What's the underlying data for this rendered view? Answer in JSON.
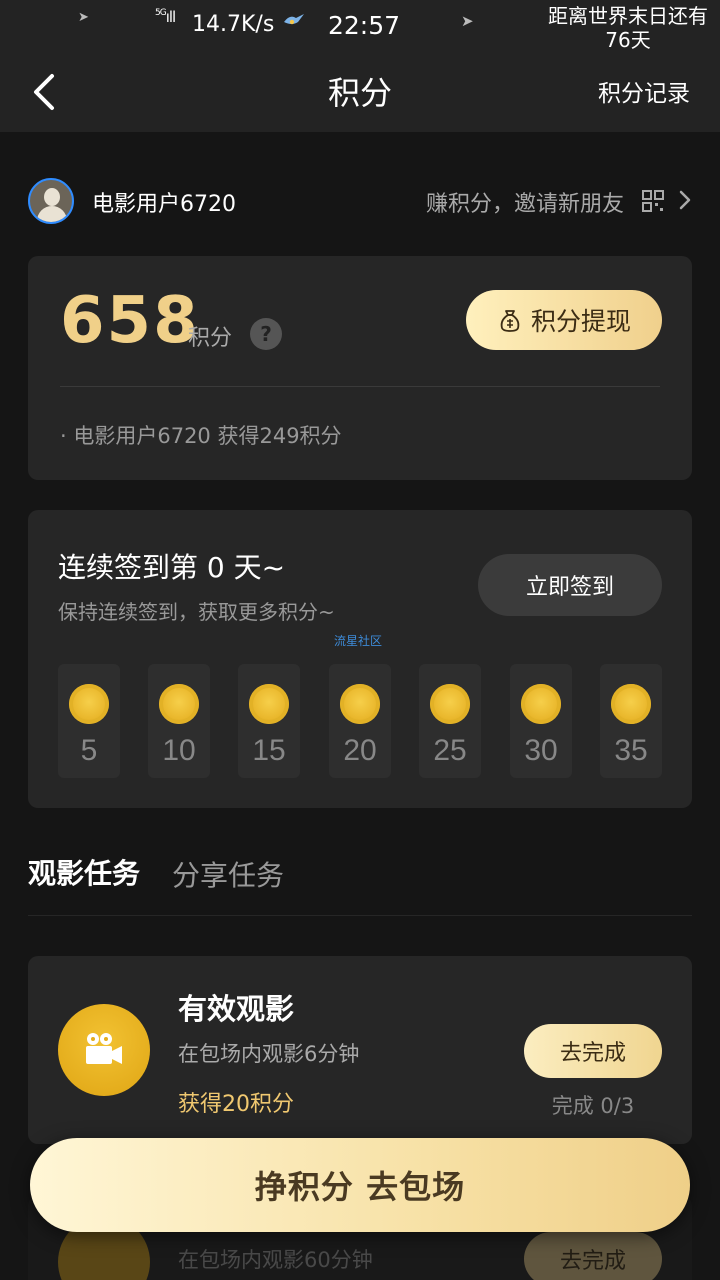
{
  "status_bar": {
    "network_speed": "14.7K/s",
    "time": "22:57",
    "signal_label": "5G",
    "countdown_text": "距离世界末日还有76天"
  },
  "nav": {
    "title": "积分",
    "record_label": "积分记录"
  },
  "user": {
    "name": "电影用户6720",
    "invite_text": "赚积分，邀请新朋友"
  },
  "points": {
    "value": "658",
    "unit": "积分",
    "help_symbol": "?",
    "withdraw_label": "积分提现",
    "gain_text": "· 电影用户6720 获得249积分"
  },
  "signin": {
    "title": "连续签到第 0 天~",
    "subtitle": "保持连续签到，获取更多积分~",
    "button_label": "立即签到",
    "watermark": "流星社区",
    "days": [
      {
        "value": "5"
      },
      {
        "value": "10"
      },
      {
        "value": "15"
      },
      {
        "value": "20"
      },
      {
        "value": "25"
      },
      {
        "value": "30"
      },
      {
        "value": "35"
      }
    ]
  },
  "tabs": [
    {
      "label": "观影任务",
      "active": true
    },
    {
      "label": "分享任务",
      "active": false
    }
  ],
  "tasks": [
    {
      "title": "有效观影",
      "desc": "在包场内观影6分钟",
      "reward": "获得20积分",
      "button": "去完成",
      "progress": "完成 0/3",
      "icon": "movie-camera-icon"
    },
    {
      "desc": "在包场内观影60分钟",
      "button": "去完成",
      "icon": "movie-camera-icon"
    }
  ],
  "cta": {
    "label": "挣积分 去包场"
  },
  "colors": {
    "background": "#151515",
    "card": "#262626",
    "accent_gold": "#f0d089",
    "reward_gold": "#f0c870"
  }
}
